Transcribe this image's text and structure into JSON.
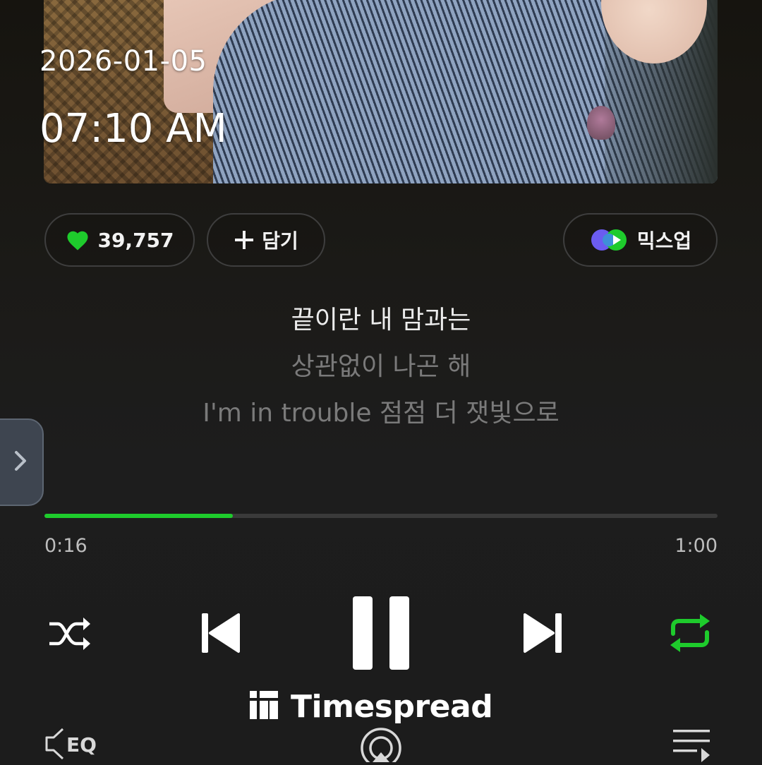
{
  "status": {
    "date": "2026-01-05",
    "time": "07:10 AM"
  },
  "actions": {
    "like_count": "39,757",
    "add_label": "담기",
    "mixup_label": "믹스업"
  },
  "lyrics": {
    "current": "끝이란 내 맘과는",
    "next": "상관없이 나곤 해",
    "after": "I'm in trouble 점점 더 잿빛으로"
  },
  "playback": {
    "current_time": "0:16",
    "total_time": "1:00",
    "progress": 0.28,
    "state": "playing",
    "repeat": "on"
  },
  "bottom_bar": {
    "eq_label": "EQ"
  },
  "brand": {
    "name": "Timespread"
  },
  "colors": {
    "accent": "#1ecb2c",
    "background": "#1c1c1c",
    "muted_text": "#7a7a7a"
  },
  "icons": [
    "heart-icon",
    "plus-icon",
    "mixup-icon",
    "chevron-right-icon",
    "shuffle-icon",
    "previous-icon",
    "pause-icon",
    "next-icon",
    "repeat-icon",
    "timespread-logo-icon",
    "eq-icon",
    "cast-icon",
    "playlist-icon"
  ]
}
